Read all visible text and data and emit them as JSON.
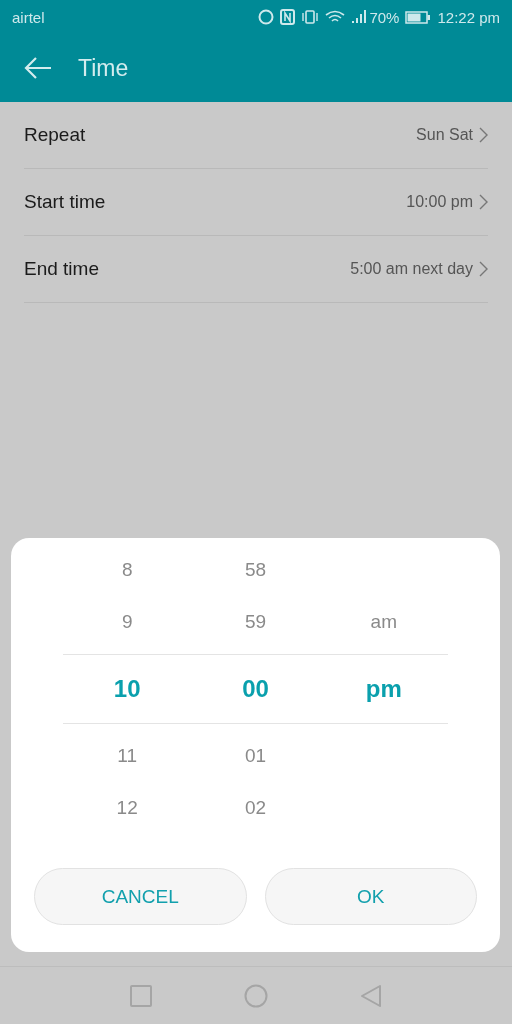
{
  "status_bar": {
    "carrier": "airtel",
    "battery_text": "70%",
    "time": "12:22 pm"
  },
  "app_bar": {
    "title": "Time"
  },
  "settings": [
    {
      "label": "Repeat",
      "value": "Sun Sat"
    },
    {
      "label": "Start time",
      "value": "10:00 pm"
    },
    {
      "label": "End time",
      "value": "5:00 am next day"
    }
  ],
  "picker": {
    "rows": [
      {
        "hour": "8",
        "minute": "58",
        "selected": false
      },
      {
        "hour": "9",
        "minute": "59",
        "period": "am",
        "selected": false
      },
      {
        "hour": "10",
        "minute": "00",
        "period": "pm",
        "selected": true
      },
      {
        "hour": "11",
        "minute": "01",
        "selected": false
      },
      {
        "hour": "12",
        "minute": "02",
        "selected": false
      }
    ],
    "buttons": [
      "CANCEL",
      "OK"
    ]
  }
}
